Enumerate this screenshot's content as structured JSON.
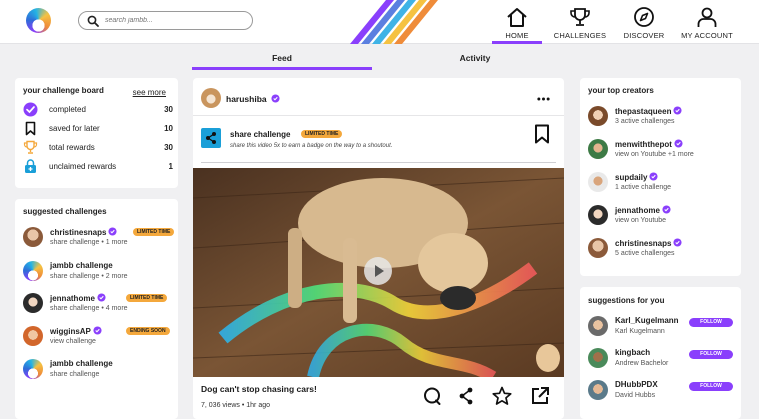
{
  "search": {
    "placeholder": "search jambb..."
  },
  "nav": [
    {
      "label": "HOME",
      "icon": "home-icon",
      "active": true
    },
    {
      "label": "CHALLENGES",
      "icon": "trophy-icon",
      "active": false
    },
    {
      "label": "DISCOVER",
      "icon": "compass-icon",
      "active": false
    },
    {
      "label": "MY ACCOUNT",
      "icon": "user-icon",
      "active": false
    }
  ],
  "tabs": [
    {
      "label": "Feed",
      "active": true
    },
    {
      "label": "Activity",
      "active": false
    }
  ],
  "board": {
    "title": "your challenge board",
    "see_more": "see more",
    "rows": [
      {
        "label": "completed",
        "value": "30",
        "icon": "check-circle-icon"
      },
      {
        "label": "saved for later",
        "value": "10",
        "icon": "bookmark-icon"
      },
      {
        "label": "total rewards",
        "value": "30",
        "icon": "trophy-icon"
      },
      {
        "label": "unclaimed rewards",
        "value": "1",
        "icon": "gift-lock-icon"
      }
    ]
  },
  "suggested": {
    "title": "suggested challenges",
    "items": [
      {
        "name": "christinesnaps",
        "sub": "share challenge • 1 more",
        "verified": true,
        "badge": "LIMITED TIME"
      },
      {
        "name": "jambb challenge",
        "sub": "share challenge • 2 more",
        "verified": false,
        "badge": ""
      },
      {
        "name": "jennathome",
        "sub": "share challenge • 4 more",
        "verified": true,
        "badge": "LIMITED TIME"
      },
      {
        "name": "wigginsAP",
        "sub": "view challenge",
        "verified": true,
        "badge": "ENDING SOON"
      },
      {
        "name": "jambb challenge",
        "sub": "share challenge",
        "verified": false,
        "badge": ""
      }
    ]
  },
  "post": {
    "author": "harushiba",
    "challenge_title": "share challenge",
    "challenge_badge": "LIMITED TIME",
    "challenge_desc": "share this video 5x to earn a badge on the way to a shoutout.",
    "title": "Dog can't stop chasing cars!",
    "meta": "7, 036 views • 1hr ago"
  },
  "creators": {
    "title": "your top creators",
    "items": [
      {
        "name": "thepastaqueen",
        "sub": "3 active challenges"
      },
      {
        "name": "menwiththepot",
        "sub": "view on Youtube +1 more"
      },
      {
        "name": "supdaily",
        "sub": "1 active challenge"
      },
      {
        "name": "jennathome",
        "sub": "view on Youtube"
      },
      {
        "name": "christinesnaps",
        "sub": "5 active challenges"
      }
    ]
  },
  "suggestions": {
    "title": "suggestions for you",
    "follow_label": "FOLLOW",
    "items": [
      {
        "name": "Karl_Kugelmann",
        "sub": "Karl Kugelmann"
      },
      {
        "name": "kingbach",
        "sub": "Andrew Bachelor"
      },
      {
        "name": "DHubbPDX",
        "sub": "David Hubbs"
      }
    ]
  },
  "colors": {
    "accent": "#8a3ffc",
    "badge": "#f4a83c",
    "share_blue": "#1a9fd8"
  }
}
